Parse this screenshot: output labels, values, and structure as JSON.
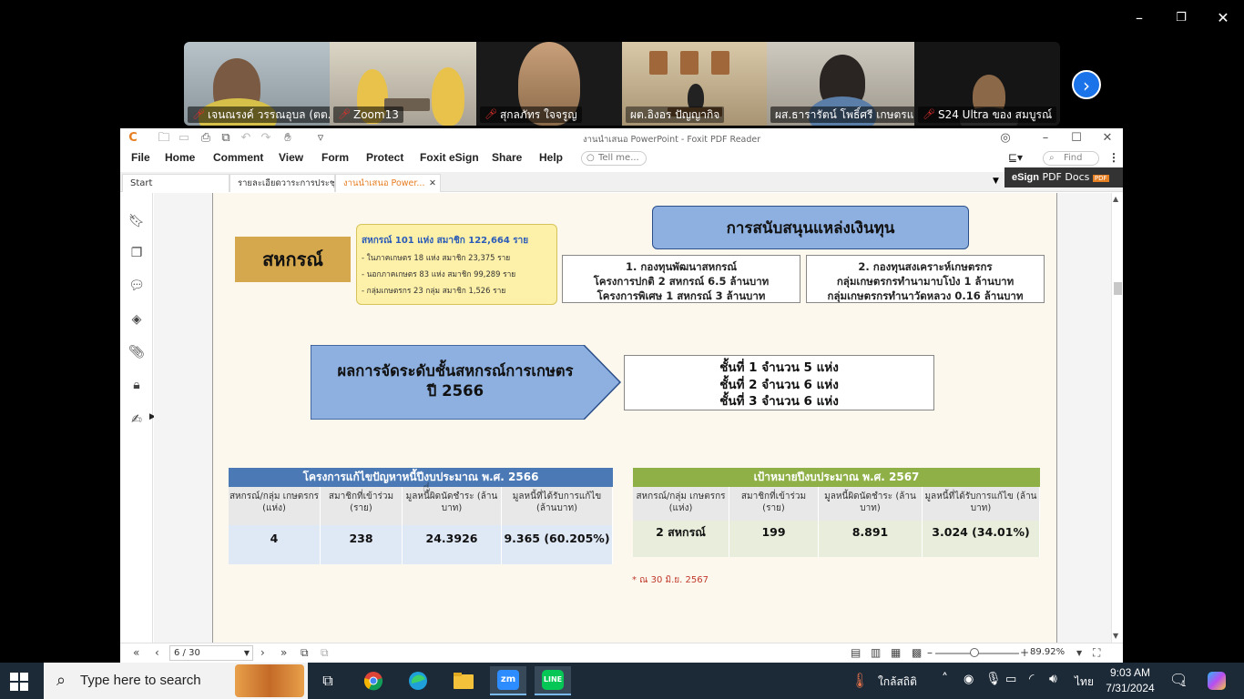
{
  "zoom": {
    "controls": [
      "–",
      "❐",
      "✕"
    ],
    "participants": [
      {
        "name": "เจนณรงค์ วรรณอุบล (ตต..."
      },
      {
        "name": "Zoom13"
      },
      {
        "name": "สุกลภัทร ใจจรูญ"
      },
      {
        "name": "ผต.อิงอร ปัญญากิจ"
      },
      {
        "name": "ผส.ธารารัตน์ โพธิ์ศรี เกษตรแ..."
      },
      {
        "name": "S24 Ultra ของ สมบูรณ์"
      }
    ]
  },
  "foxit": {
    "title": "งานนำเสนอ PowerPoint - Foxit PDF Reader",
    "menu": [
      "File",
      "Home",
      "Comment",
      "View",
      "Form",
      "Protect",
      "Foxit eSign",
      "Share",
      "Help"
    ],
    "tell_me": "Tell me...",
    "find": "Find",
    "tabs": [
      "Start",
      "รายละเอียดวาระการประชุม ...",
      "งานนำเสนอ Power..."
    ],
    "esign_label": "eSign",
    "esign_sub": "PDF Docs",
    "esign_badge": "PDF",
    "page_indicator": "6 / 30",
    "zoom_level": "89.92%"
  },
  "slide": {
    "coop_label": "สหกรณ์",
    "coop_info": {
      "line1": "สหกรณ์ 101 แห่ง สมาชิก 122,664 ราย",
      "lines": [
        "- ในภาคเกษตร 18 แห่ง สมาชิก 23,375 ราย",
        "- นอกภาคเกษตร 83 แห่ง สมาชิก 99,289 ราย",
        "- กลุ่มเกษตรกร 23 กลุ่ม สมาชิก 1,526 ราย"
      ]
    },
    "fund_title": "การสนับสนุนแหล่งเงินทุน",
    "fund1": [
      "1. กองทุนพัฒนาสหกรณ์",
      "โครงการปกติ 2 สหกรณ์ 6.5 ล้านบาท",
      "โครงการพิเศษ 1 สหกรณ์ 3 ล้านบาท"
    ],
    "fund2": [
      "2. กองทุนสงเคราะห์เกษตรกร",
      "กลุ่มเกษตรกรทำนามาบโป่ง 1 ล้านบาท",
      "กลุ่มเกษตรกรทำนาวัดหลวง 0.16 ล้านบาท"
    ],
    "rank_title": [
      "ผลการจัดระดับชั้นสหกรณ์การเกษตร",
      "ปี 2566"
    ],
    "rank_results": [
      "ชั้นที่ 1  จำนวน 5 แห่ง",
      "ชั้นที่ 2  จำนวน 6 แห่ง",
      "ชั้นที่ 3  จำนวน 6 แห่ง"
    ],
    "table1": {
      "title": "โครงการแก้ไขปัญหาหนี้ปีงบประมาณ พ.ศ. 2566",
      "headers": [
        "สหกรณ์/กลุ่ม เกษตรกร (แห่ง)",
        "สมาชิกที่เข้าร่วม (ราย)",
        "มูลหนี้ผิดนัดชำระ (ล้านบาท)",
        "มูลหนี้ที่ได้รับการแก้ไข (ล้านบาท)"
      ],
      "row": [
        "4",
        "238",
        "24.3926",
        "9.365 (60.205%)"
      ]
    },
    "table2": {
      "title": "เป้าหมายปีงบประมาณ พ.ศ. 2567",
      "headers": [
        "สหกรณ์/กลุ่ม เกษตรกร (แห่ง)",
        "สมาชิกที่เข้าร่วม (ราย)",
        "มูลหนี้ผิดนัดชำระ (ล้านบาท)",
        "มูลหนี้ที่ได้รับการแก้ไข (ล้านบาท)"
      ],
      "row": [
        "2 สหกรณ์",
        "199",
        "8.891",
        "3.024 (34.01%)"
      ]
    },
    "note": "* ณ 30 มิ.ย. 2567"
  },
  "taskbar": {
    "search_placeholder": "Type here to search",
    "weather": "ใกล้สถิติ",
    "lang": "ไทย",
    "time": "9:03 AM",
    "date": "7/31/2024",
    "notif_count": "1"
  },
  "colors": {
    "table1_header": "#4a79b5",
    "table2_header": "#8eb046",
    "foxit_accent": "#e67e22",
    "zoom_active": "#25c25c",
    "taskbar_bg": "#1c2a38"
  }
}
